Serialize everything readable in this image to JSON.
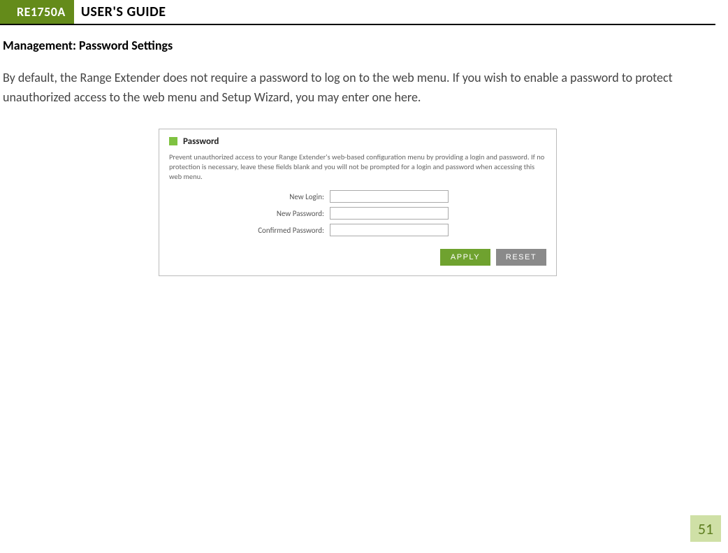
{
  "header": {
    "model": "RE1750A",
    "title": "USER'S GUIDE"
  },
  "section": {
    "heading": "Management: Password Settings",
    "body": "By default, the Range Extender does not require a password to log on to the web menu. If you wish to enable a password to protect unauthorized access to the web menu and Setup Wizard, you may enter one here."
  },
  "panel": {
    "title": "Password",
    "description": "Prevent unauthorized access to your Range Extender's web-based configuration menu by providing a login and password. If no protection is necessary, leave these fields blank and you will not be prompted for a login and password when accessing this web menu.",
    "fields": {
      "new_login_label": "New Login:",
      "new_login_value": "",
      "new_password_label": "New Password:",
      "new_password_value": "",
      "confirmed_password_label": "Confirmed Password:",
      "confirmed_password_value": ""
    },
    "buttons": {
      "apply": "APPLY",
      "reset": "RESET"
    }
  },
  "page_number": "51"
}
